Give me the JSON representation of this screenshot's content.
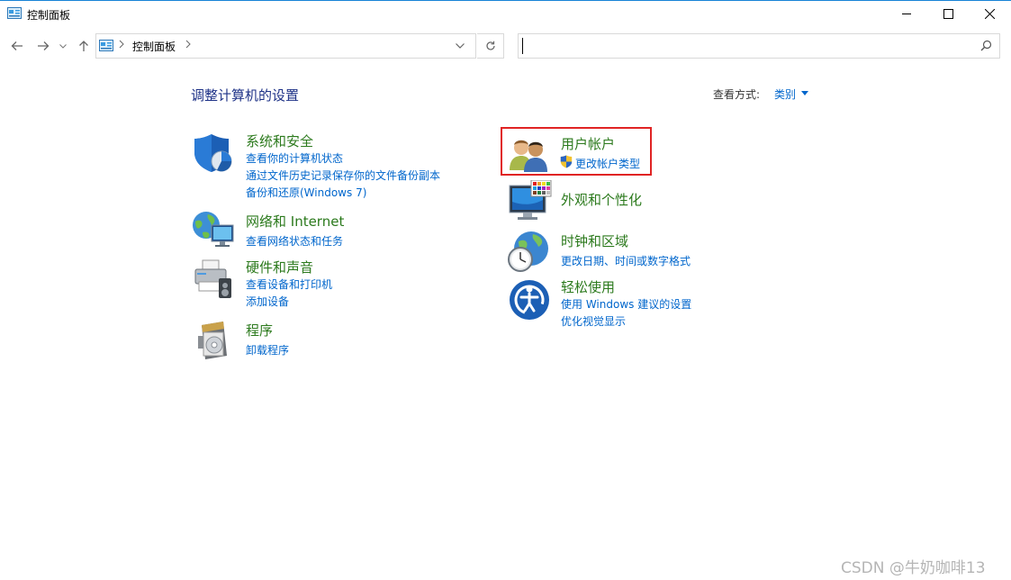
{
  "window": {
    "title": "控制面板",
    "minimize_icon": "minimize-icon",
    "maximize_icon": "maximize-icon",
    "close_icon": "close-icon"
  },
  "nav": {
    "breadcrumb": "控制面板",
    "search_value": ""
  },
  "main": {
    "heading": "调整计算机的设置",
    "view_by_label": "查看方式:",
    "view_by_value": "类别"
  },
  "left_categories": [
    {
      "title": "系统和安全",
      "icon": "shield-icon",
      "links": [
        "查看你的计算机状态",
        "通过文件历史记录保存你的文件备份副本",
        "备份和还原(Windows 7)"
      ]
    },
    {
      "title": "网络和 Internet",
      "icon": "network-globe-icon",
      "links": [
        "查看网络状态和任务"
      ]
    },
    {
      "title": "硬件和声音",
      "icon": "printer-icon",
      "links": [
        "查看设备和打印机",
        "添加设备"
      ]
    },
    {
      "title": "程序",
      "icon": "programs-disc-icon",
      "links": [
        "卸载程序"
      ]
    }
  ],
  "right_categories": [
    {
      "title": "用户帐户",
      "icon": "users-icon",
      "links": [
        "更改帐户类型"
      ]
    },
    {
      "title": "外观和个性化",
      "icon": "monitor-palette-icon",
      "links": []
    },
    {
      "title": "时钟和区域",
      "icon": "clock-globe-icon",
      "links": [
        "更改日期、时间或数字格式"
      ]
    },
    {
      "title": "轻松使用",
      "icon": "ease-of-access-icon",
      "links": [
        "使用 Windows 建议的设置",
        "优化视觉显示"
      ]
    }
  ],
  "colors": {
    "category_title": "#2c7a1d",
    "link": "#0066cc",
    "heading": "#1e3287",
    "highlight_box": "#e02424"
  },
  "watermark": "CSDN @牛奶咖啡13"
}
